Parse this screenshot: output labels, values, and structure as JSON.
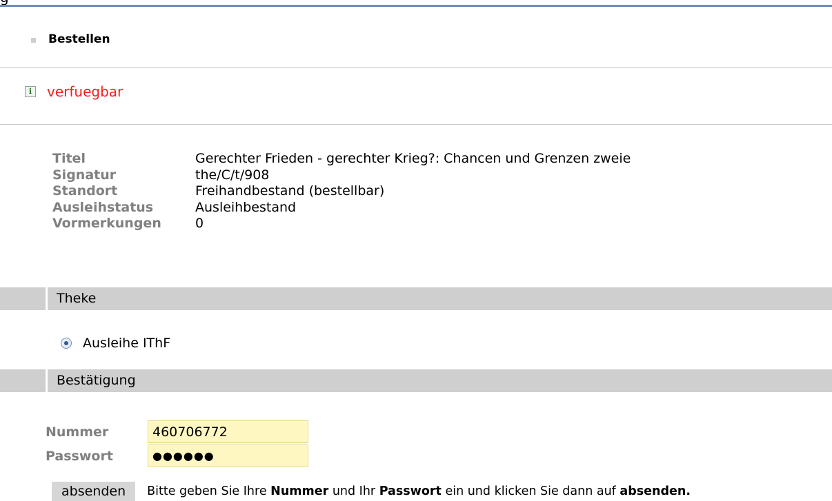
{
  "header": {
    "cut_text": "g"
  },
  "order": {
    "label": "Bestellen"
  },
  "status": {
    "text": "verfuegbar",
    "icon": "info-icon"
  },
  "details": [
    {
      "key": "Titel",
      "value": "Gerechter Frieden - gerechter Krieg?: Chancen und Grenzen zweie"
    },
    {
      "key": "Signatur",
      "value": "the/C/t/908"
    },
    {
      "key": "Standort",
      "value": "Freihandbestand (bestellbar)"
    },
    {
      "key": "Ausleihstatus",
      "value": "Ausleihbestand"
    },
    {
      "key": "Vormerkungen",
      "value": "0"
    }
  ],
  "sections": {
    "counter": "Theke",
    "confirm": "Bestätigung"
  },
  "counter_option": {
    "label": "Ausleihe IThF",
    "selected": true
  },
  "form": {
    "number_label": "Nummer",
    "number_value": "460706772",
    "password_label": "Passwort",
    "password_mask": "●●●●●●",
    "submit_label": "absenden"
  },
  "hint": {
    "part1": "Bitte geben Sie Ihre ",
    "bold1": "Nummer",
    "part2": " und Ihr ",
    "bold2": "Passwort",
    "part3": " ein und klicken Sie dann auf ",
    "bold3": "absenden."
  },
  "colors": {
    "status": "#ff1a1a",
    "label_grey": "#808080",
    "section_bar": "#cfcfcf",
    "field_bg": "#fff7c2",
    "top_rule": "#6f8fb8"
  }
}
